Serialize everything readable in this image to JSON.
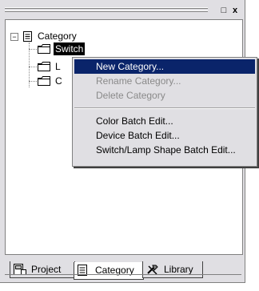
{
  "window": {
    "restore_glyph": "□",
    "close_glyph": "x"
  },
  "tree": {
    "root": {
      "label": "Category",
      "expander": "−"
    },
    "children": [
      {
        "label": "Switch"
      },
      {
        "label": "L"
      },
      {
        "label": "C"
      }
    ]
  },
  "context_menu": {
    "items": [
      {
        "label": "New Category...",
        "state": "highlighted"
      },
      {
        "label": "Rename Category...",
        "state": "disabled"
      },
      {
        "label": "Delete Category",
        "state": "disabled"
      },
      {
        "label": "Color Batch Edit...",
        "state": "enabled"
      },
      {
        "label": "Device Batch Edit...",
        "state": "enabled"
      },
      {
        "label": "Switch/Lamp Shape Batch Edit...",
        "state": "enabled"
      }
    ]
  },
  "tabs": [
    {
      "label": "Project",
      "icon": "project-icon",
      "active": false
    },
    {
      "label": "Category",
      "icon": "category-icon",
      "active": true
    },
    {
      "label": "Library",
      "icon": "library-icon",
      "active": false
    }
  ],
  "colors": {
    "panel_bg": "#e0dfe3",
    "menu_highlight": "#0a246a",
    "selection_bg": "#000000"
  }
}
